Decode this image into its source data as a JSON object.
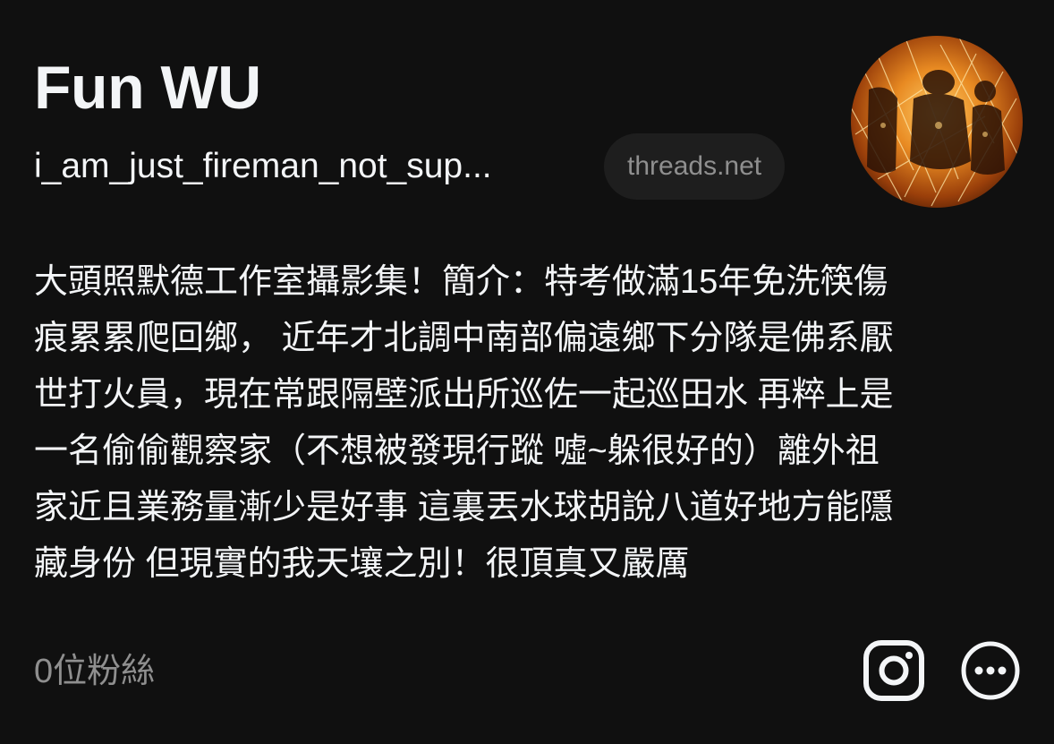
{
  "profile": {
    "name": "Fun WU",
    "handle": "i_am_just_fireman_not_sup...",
    "domain_badge": "threads.net",
    "avatar_description": "profile photo of firefighter amid orange sparks",
    "bio_lines": [
      "大頭照默德工作室攝影集！簡介：特考做滿15年免洗筷傷",
      "痕累累爬回鄉， 近年才北調中南部偏遠鄉下分隊是佛系厭",
      "世打火員，現在常跟隔壁派出所巡佐一起巡田水 再粹上是",
      "一名偷偷觀察家（不想被發現行蹤 噓~躲很好的）離外祖",
      "家近且業務量漸少是好事 這裏丟水球胡說八道好地方能隱",
      "藏身份 但現實的我天壤之別！很頂真又嚴厲"
    ],
    "followers": "0位粉絲"
  },
  "icons": {
    "instagram": "instagram-icon",
    "more": "more-options-icon"
  },
  "colors": {
    "background": "#101010",
    "text_primary": "#f3f5f7",
    "text_secondary": "#8f8f8f",
    "pill_background": "#1e1e1e"
  }
}
